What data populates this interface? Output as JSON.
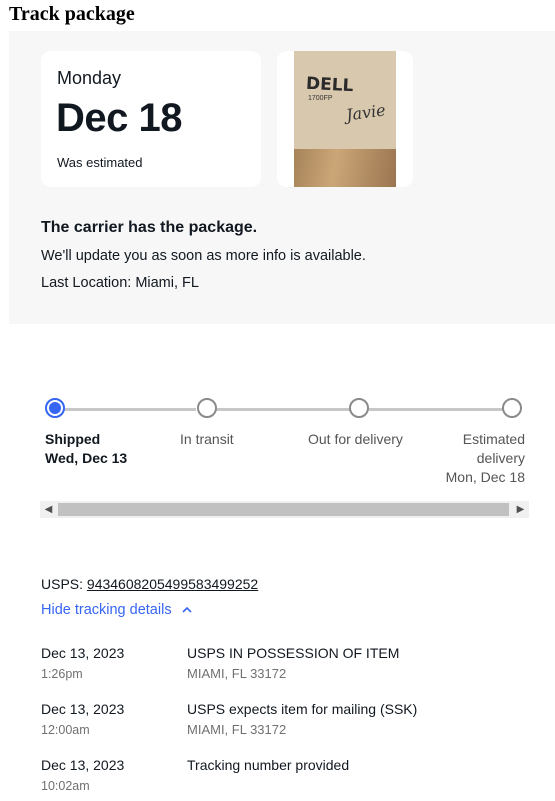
{
  "page_title": "Track package",
  "summary": {
    "day": "Monday",
    "date": "Dec 18",
    "note": "Was estimated",
    "status_heading": "The carrier has the package.",
    "status_sub": "We'll update you as soon as more info is available.",
    "last_location": "Last Location: Miami, FL",
    "photo": {
      "logo": "DELL",
      "model": "1700FP",
      "handwriting": "Javie"
    }
  },
  "progress": {
    "steps": [
      {
        "label": "Shipped",
        "sub": "Wed, Dec 13",
        "active": true
      },
      {
        "label": "In transit",
        "sub": "",
        "active": false
      },
      {
        "label": "Out for delivery",
        "sub": "",
        "active": false
      },
      {
        "label": "Estimated delivery",
        "sub": "Mon, Dec 18",
        "active": false
      }
    ],
    "estimated_line1": "Estimated",
    "estimated_line2": "delivery"
  },
  "scrollbar": {
    "left_arrow": "◀",
    "right_arrow": "▶"
  },
  "tracking": {
    "carrier_label": "USPS:",
    "number": "9434608205499583499252",
    "toggle_label": "Hide tracking details",
    "toggle_icon": "chevron-up-icon",
    "events": [
      {
        "date": "Dec 13, 2023",
        "time": "1:26pm",
        "event": "USPS IN POSSESSION OF ITEM",
        "location": "MIAMI, FL 33172"
      },
      {
        "date": "Dec 13, 2023",
        "time": "12:00am",
        "event": "USPS expects item for mailing (SSK)",
        "location": "MIAMI, FL 33172"
      },
      {
        "date": "Dec 13, 2023",
        "time": "10:02am",
        "event": "Tracking number provided",
        "location": ""
      }
    ]
  },
  "colors": {
    "accent": "#3665f3",
    "panel_bg": "#f7f7f7",
    "muted": "#707070"
  }
}
